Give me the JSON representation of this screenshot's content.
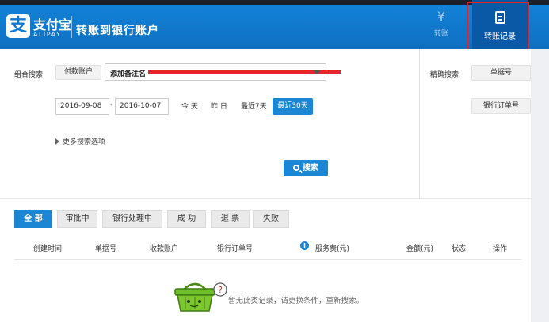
{
  "header": {
    "logo_char": "支",
    "logo_name": "支付宝",
    "logo_sub": "ALIPAY",
    "title": "转账到银行账户",
    "nav": [
      {
        "label": "转账",
        "icon": "yen-icon"
      },
      {
        "label": "转账记录",
        "icon": "clipboard-icon",
        "active": true
      }
    ]
  },
  "search": {
    "combo_label": "组合搜索",
    "account_btn": "付款账户",
    "select_value": "添加备注名",
    "date_from": "2016-09-08",
    "date_sep": "-",
    "date_to": "2016-10-07",
    "quick": [
      "今 天",
      "昨 日",
      "最近7天",
      "最近30天"
    ],
    "more_options": "更多搜索选项",
    "search_btn": "搜索",
    "precise_label": "精确搜索",
    "precise_options": [
      "单据号",
      "银行订单号"
    ]
  },
  "tabs": [
    "全 部",
    "审批中",
    "银行处理中",
    "成 功",
    "退 票",
    "失败"
  ],
  "table": {
    "columns": [
      "创建时间",
      "单据号",
      "收款账户",
      "银行订单号",
      "服务费(元)",
      "金额(元)",
      "状态",
      "操作"
    ],
    "empty_message": "暂无此类记录，请更换条件，重新搜索。"
  },
  "colors": {
    "brand_blue": "#1282d8",
    "accent_blue": "#1b86d4",
    "highlight_red": "#e0262b"
  }
}
